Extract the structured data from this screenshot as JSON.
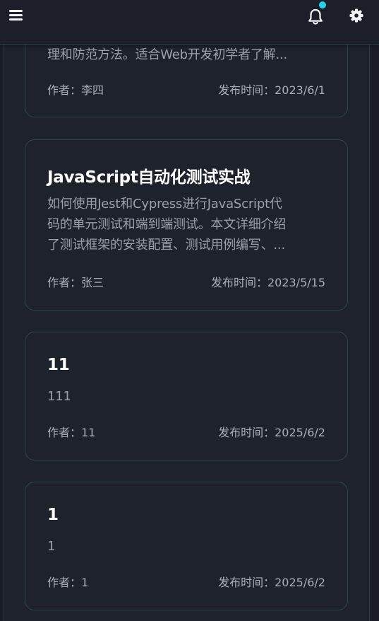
{
  "topbar": {
    "menu_icon": "menu-icon",
    "notification_icon": "bell-icon",
    "notification_dot_color": "#22d3ee",
    "settings_icon": "gear-icon"
  },
  "articles": [
    {
      "title": "",
      "summary_lines": [
        "理和防范方法。适合Web开发初学者了解..."
      ],
      "author": "作者：李四",
      "date": "发布时间：2023/6/1"
    },
    {
      "title": "JavaScript自动化测试实战",
      "summary_lines": [
        "如何使用Jest和Cypress进行JavaScript代",
        "码的单元测试和端到端测试。本文详细介绍",
        "了测试框架的安装配置、测试用例编写、..."
      ],
      "author": "作者：张三",
      "date": "发布时间：2023/5/15"
    },
    {
      "title": "11",
      "summary_lines": [
        "111"
      ],
      "author": "作者：11",
      "date": "发布时间：2025/6/2"
    },
    {
      "title": "1",
      "summary_lines": [
        "1"
      ],
      "author": "作者：1",
      "date": "发布时间：2025/6/2"
    }
  ]
}
